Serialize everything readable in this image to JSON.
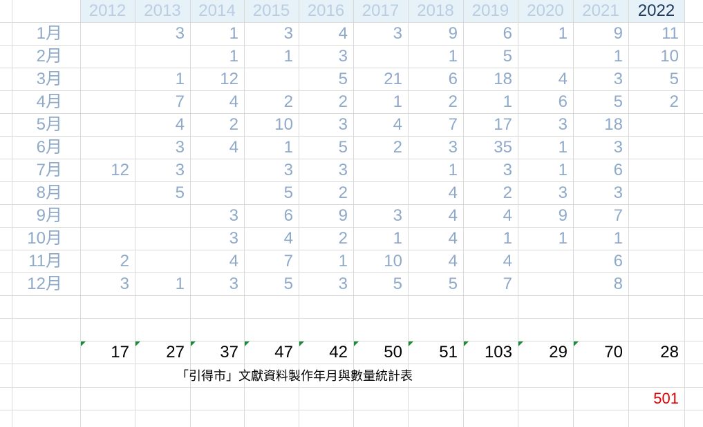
{
  "table": {
    "years": [
      "2012",
      "2013",
      "2014",
      "2015",
      "2016",
      "2017",
      "2018",
      "2019",
      "2020",
      "2021",
      "2022"
    ],
    "current_year_index": 10,
    "rows": [
      {
        "month": "1月",
        "values": [
          "",
          "3",
          "1",
          "3",
          "4",
          "3",
          "9",
          "6",
          "1",
          "9",
          "11"
        ]
      },
      {
        "month": "2月",
        "values": [
          "",
          "",
          "1",
          "1",
          "3",
          "",
          "1",
          "5",
          "",
          "1",
          "10"
        ]
      },
      {
        "month": "3月",
        "values": [
          "",
          "1",
          "12",
          "",
          "5",
          "21",
          "6",
          "18",
          "4",
          "3",
          "5"
        ]
      },
      {
        "month": "4月",
        "values": [
          "",
          "7",
          "4",
          "2",
          "2",
          "1",
          "2",
          "1",
          "6",
          "5",
          "2"
        ]
      },
      {
        "month": "5月",
        "values": [
          "",
          "4",
          "2",
          "10",
          "3",
          "4",
          "7",
          "17",
          "3",
          "18",
          ""
        ]
      },
      {
        "month": "6月",
        "values": [
          "",
          "3",
          "4",
          "1",
          "5",
          "2",
          "3",
          "35",
          "1",
          "3",
          ""
        ]
      },
      {
        "month": "7月",
        "values": [
          "12",
          "3",
          "",
          "3",
          "3",
          "",
          "1",
          "3",
          "1",
          "6",
          ""
        ]
      },
      {
        "month": "8月",
        "values": [
          "",
          "5",
          "",
          "5",
          "2",
          "",
          "4",
          "2",
          "3",
          "3",
          ""
        ]
      },
      {
        "month": "9月",
        "values": [
          "",
          "",
          "3",
          "6",
          "9",
          "3",
          "4",
          "4",
          "9",
          "7",
          ""
        ]
      },
      {
        "month": "10月",
        "values": [
          "",
          "",
          "3",
          "4",
          "2",
          "1",
          "4",
          "1",
          "1",
          "1",
          ""
        ]
      },
      {
        "month": "11月",
        "values": [
          "2",
          "",
          "4",
          "7",
          "1",
          "10",
          "4",
          "4",
          "",
          "6",
          ""
        ]
      },
      {
        "month": "12月",
        "values": [
          "3",
          "1",
          "3",
          "5",
          "3",
          "5",
          "5",
          "7",
          "",
          "8",
          ""
        ]
      }
    ],
    "totals": [
      "17",
      "27",
      "37",
      "47",
      "42",
      "50",
      "51",
      "103",
      "29",
      "70",
      "28"
    ],
    "caption": "「引得市」文獻資料製作年月與數量統計表",
    "grand_total": "501"
  },
  "colors": {
    "header_band": "#e7f1f8",
    "header_text": "#b9cde3",
    "header_current_text": "#1f3a5f",
    "cell_text": "#8fa9c9",
    "total_text": "#000000",
    "grand_total_text": "#e00000",
    "error_indicator": "#1b8a3a",
    "gridline": "#d9d9d9"
  }
}
